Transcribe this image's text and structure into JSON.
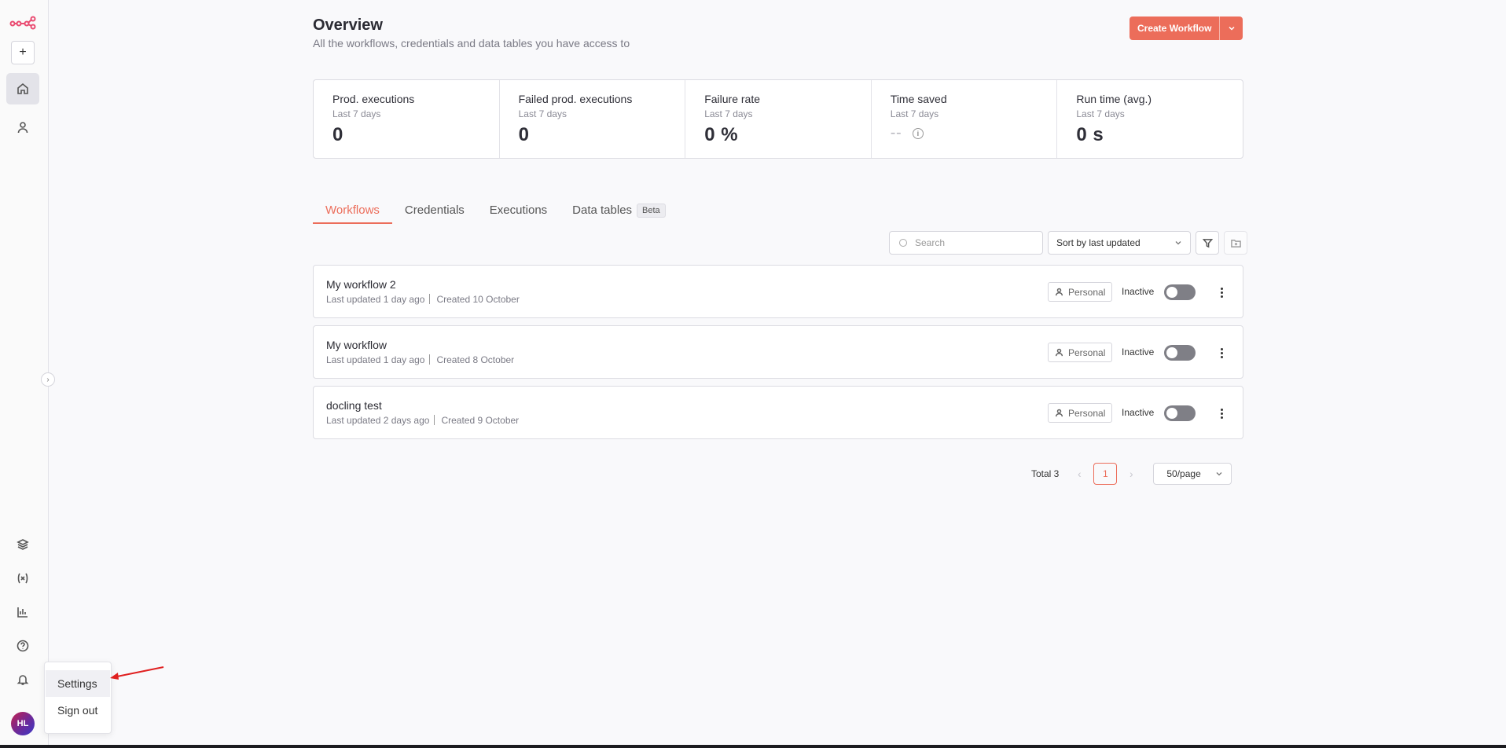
{
  "sidebar": {
    "logo_icon": "n8n-logo-icon",
    "add_icon": "plus-icon",
    "nav": [
      {
        "name": "overview",
        "icon": "home-icon",
        "active": true
      },
      {
        "name": "personal",
        "icon": "user-icon",
        "active": false
      }
    ],
    "bottom_nav": [
      {
        "name": "templates",
        "icon": "templates-icon"
      },
      {
        "name": "variables",
        "icon": "variables-icon"
      },
      {
        "name": "insights",
        "icon": "chart-icon"
      },
      {
        "name": "help",
        "icon": "help-icon"
      },
      {
        "name": "notifications",
        "icon": "bell-icon"
      }
    ],
    "avatar_initials": "HL",
    "collapse_glyph": "›"
  },
  "user_menu": {
    "items": [
      "Settings",
      "Sign out"
    ]
  },
  "header": {
    "title": "Overview",
    "subtitle": "All the workflows, credentials and data tables you have access to",
    "create_button": "Create Workflow"
  },
  "stats": [
    {
      "label": "Prod. executions",
      "sub": "Last 7 days",
      "value": "0"
    },
    {
      "label": "Failed prod. executions",
      "sub": "Last 7 days",
      "value": "0"
    },
    {
      "label": "Failure rate",
      "sub": "Last 7 days",
      "value": "0 %"
    },
    {
      "label": "Time saved",
      "sub": "Last 7 days",
      "value": "--"
    },
    {
      "label": "Run time (avg.)",
      "sub": "Last 7 days",
      "value": "0 s"
    }
  ],
  "tabs": [
    {
      "label": "Workflows",
      "active": true
    },
    {
      "label": "Credentials",
      "active": false
    },
    {
      "label": "Executions",
      "active": false
    },
    {
      "label": "Data tables",
      "active": false,
      "badge": "Beta"
    }
  ],
  "toolbar": {
    "search_placeholder": "Search",
    "sort_value": "Sort by last updated"
  },
  "workflows": [
    {
      "name": "My workflow 2",
      "updated": "Last updated 1 day ago",
      "created": "Created 10 October",
      "owner": "Personal",
      "status": "Inactive"
    },
    {
      "name": "My workflow",
      "updated": "Last updated 1 day ago",
      "created": "Created 8 October",
      "owner": "Personal",
      "status": "Inactive"
    },
    {
      "name": "docling test",
      "updated": "Last updated 2 days ago",
      "created": "Created 9 October",
      "owner": "Personal",
      "status": "Inactive"
    }
  ],
  "pagination": {
    "total": "Total 3",
    "current_page": "1",
    "page_size": "50/page"
  },
  "colors": {
    "accent": "#ec6d5a",
    "annotation_arrow": "#e02020"
  }
}
